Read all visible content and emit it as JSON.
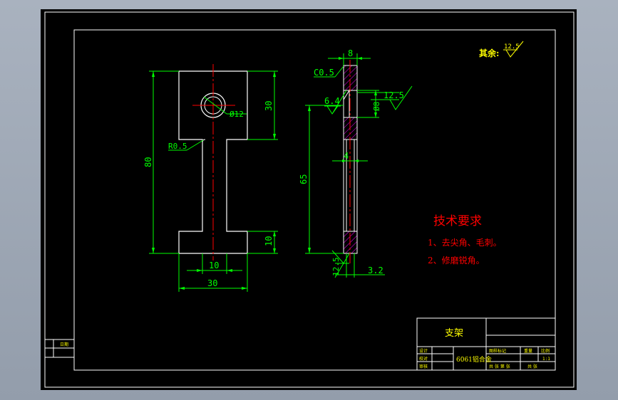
{
  "colors": {
    "background": "#000000",
    "frame": "#ffffff",
    "outline": "#ffffff",
    "dimension": "#00ff00",
    "centerline": "#ff0000",
    "hatch": "#ff00ff",
    "note_title": "#ff0000",
    "title_text": "#ffff00",
    "workspace": "#9aa4b1"
  },
  "front_view": {
    "dim_height_total": "80",
    "dim_top_block": "30",
    "dim_bottom_block": "10",
    "dim_hole": "Ø12",
    "dim_fillet": "R0.5",
    "dim_stem_width": "10",
    "dim_base_width": "30"
  },
  "side_view": {
    "dim_thickness": "8",
    "dim_chamfer": "C0.5",
    "dim_roughness_top": "6.4",
    "dim_roughness_right": "12.5",
    "dim_hole_depth": "Ø8",
    "dim_slot": "4",
    "dim_length": "65",
    "dim_roughness_bottom": "12.5",
    "dim_bottom_offset": "3.2"
  },
  "surface_note": {
    "label": "其余:",
    "value": "12.5"
  },
  "tech_requirements": {
    "title": "技术要求",
    "items": [
      "1、去尖角、毛刺。",
      "2、修磨锐角。"
    ]
  },
  "title_block": {
    "part_name": "支架",
    "material": "6061铝合金",
    "rows": [
      "设计",
      "校对",
      "审核"
    ],
    "labels": [
      "图样标记",
      "重量",
      "比例"
    ],
    "scale": "1:1",
    "sheet": "共 张 第 张",
    "footer": "共  张",
    "side_label": "日期"
  }
}
